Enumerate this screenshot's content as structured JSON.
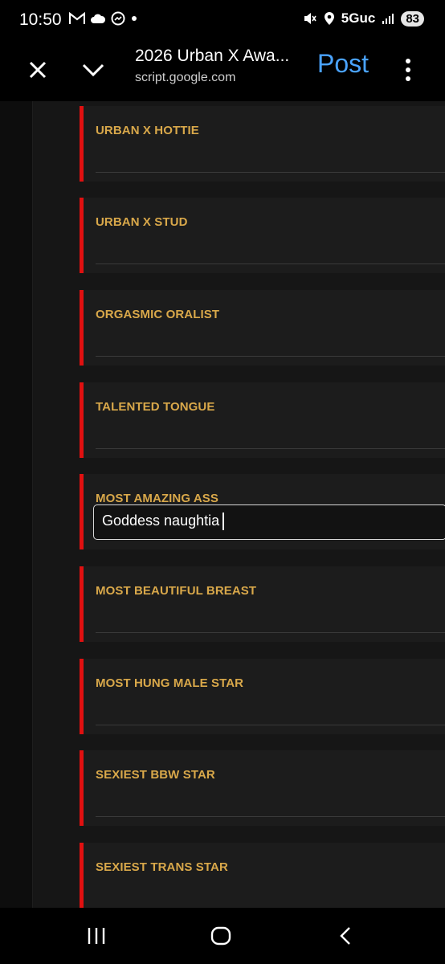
{
  "status_bar": {
    "time": "10:50",
    "network": "5Guc",
    "battery": "83"
  },
  "app_bar": {
    "title": "2026 Urban X Awa...",
    "subtitle": "script.google.com",
    "post_label": "Post"
  },
  "categories": [
    {
      "label": "URBAN X HOTTIE",
      "answer": ""
    },
    {
      "label": "URBAN X STUD",
      "answer": ""
    },
    {
      "label": "ORGASMIC ORALIST",
      "answer": ""
    },
    {
      "label": "TALENTED TONGUE",
      "answer": ""
    },
    {
      "label": "MOST AMAZING ASS",
      "answer": "Goddess naughtia"
    },
    {
      "label": "MOST BEAUTIFUL BREAST",
      "answer": ""
    },
    {
      "label": "MOST HUNG MALE STAR",
      "answer": ""
    },
    {
      "label": "SEXIEST BBW STAR",
      "answer": ""
    },
    {
      "label": "SEXIEST TRANS STAR",
      "answer": ""
    }
  ],
  "colors": {
    "accent": "#e01010",
    "label": "#d9a84a",
    "post": "#4aa3ff"
  },
  "icons": [
    "gmail-icon",
    "cloud-icon",
    "messenger-icon",
    "mute-icon",
    "location-icon",
    "signal-icon",
    "close-icon",
    "chevron-down-icon",
    "more-vert-icon",
    "recents-icon",
    "home-icon",
    "back-icon"
  ]
}
